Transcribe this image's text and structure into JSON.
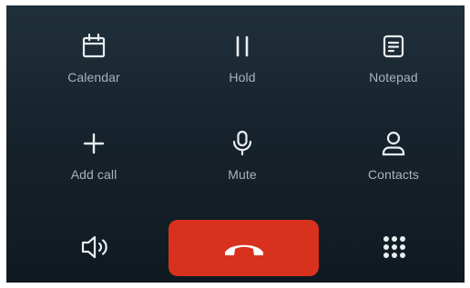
{
  "controls": {
    "calendar_label": "Calendar",
    "hold_label": "Hold",
    "notepad_label": "Notepad",
    "add_call_label": "Add call",
    "mute_label": "Mute",
    "contacts_label": "Contacts"
  },
  "icons": {
    "calendar": "calendar-icon",
    "hold": "pause-icon",
    "notepad": "notepad-icon",
    "add_call": "plus-icon",
    "mute": "microphone-icon",
    "contacts": "person-icon",
    "speaker": "speaker-icon",
    "end_call": "phone-hangup-icon",
    "dialpad": "dialpad-icon"
  },
  "colors": {
    "end_call": "#d8321e",
    "background": "#17232c",
    "label": "#a8b3ba",
    "icon": "#e8edf0"
  }
}
